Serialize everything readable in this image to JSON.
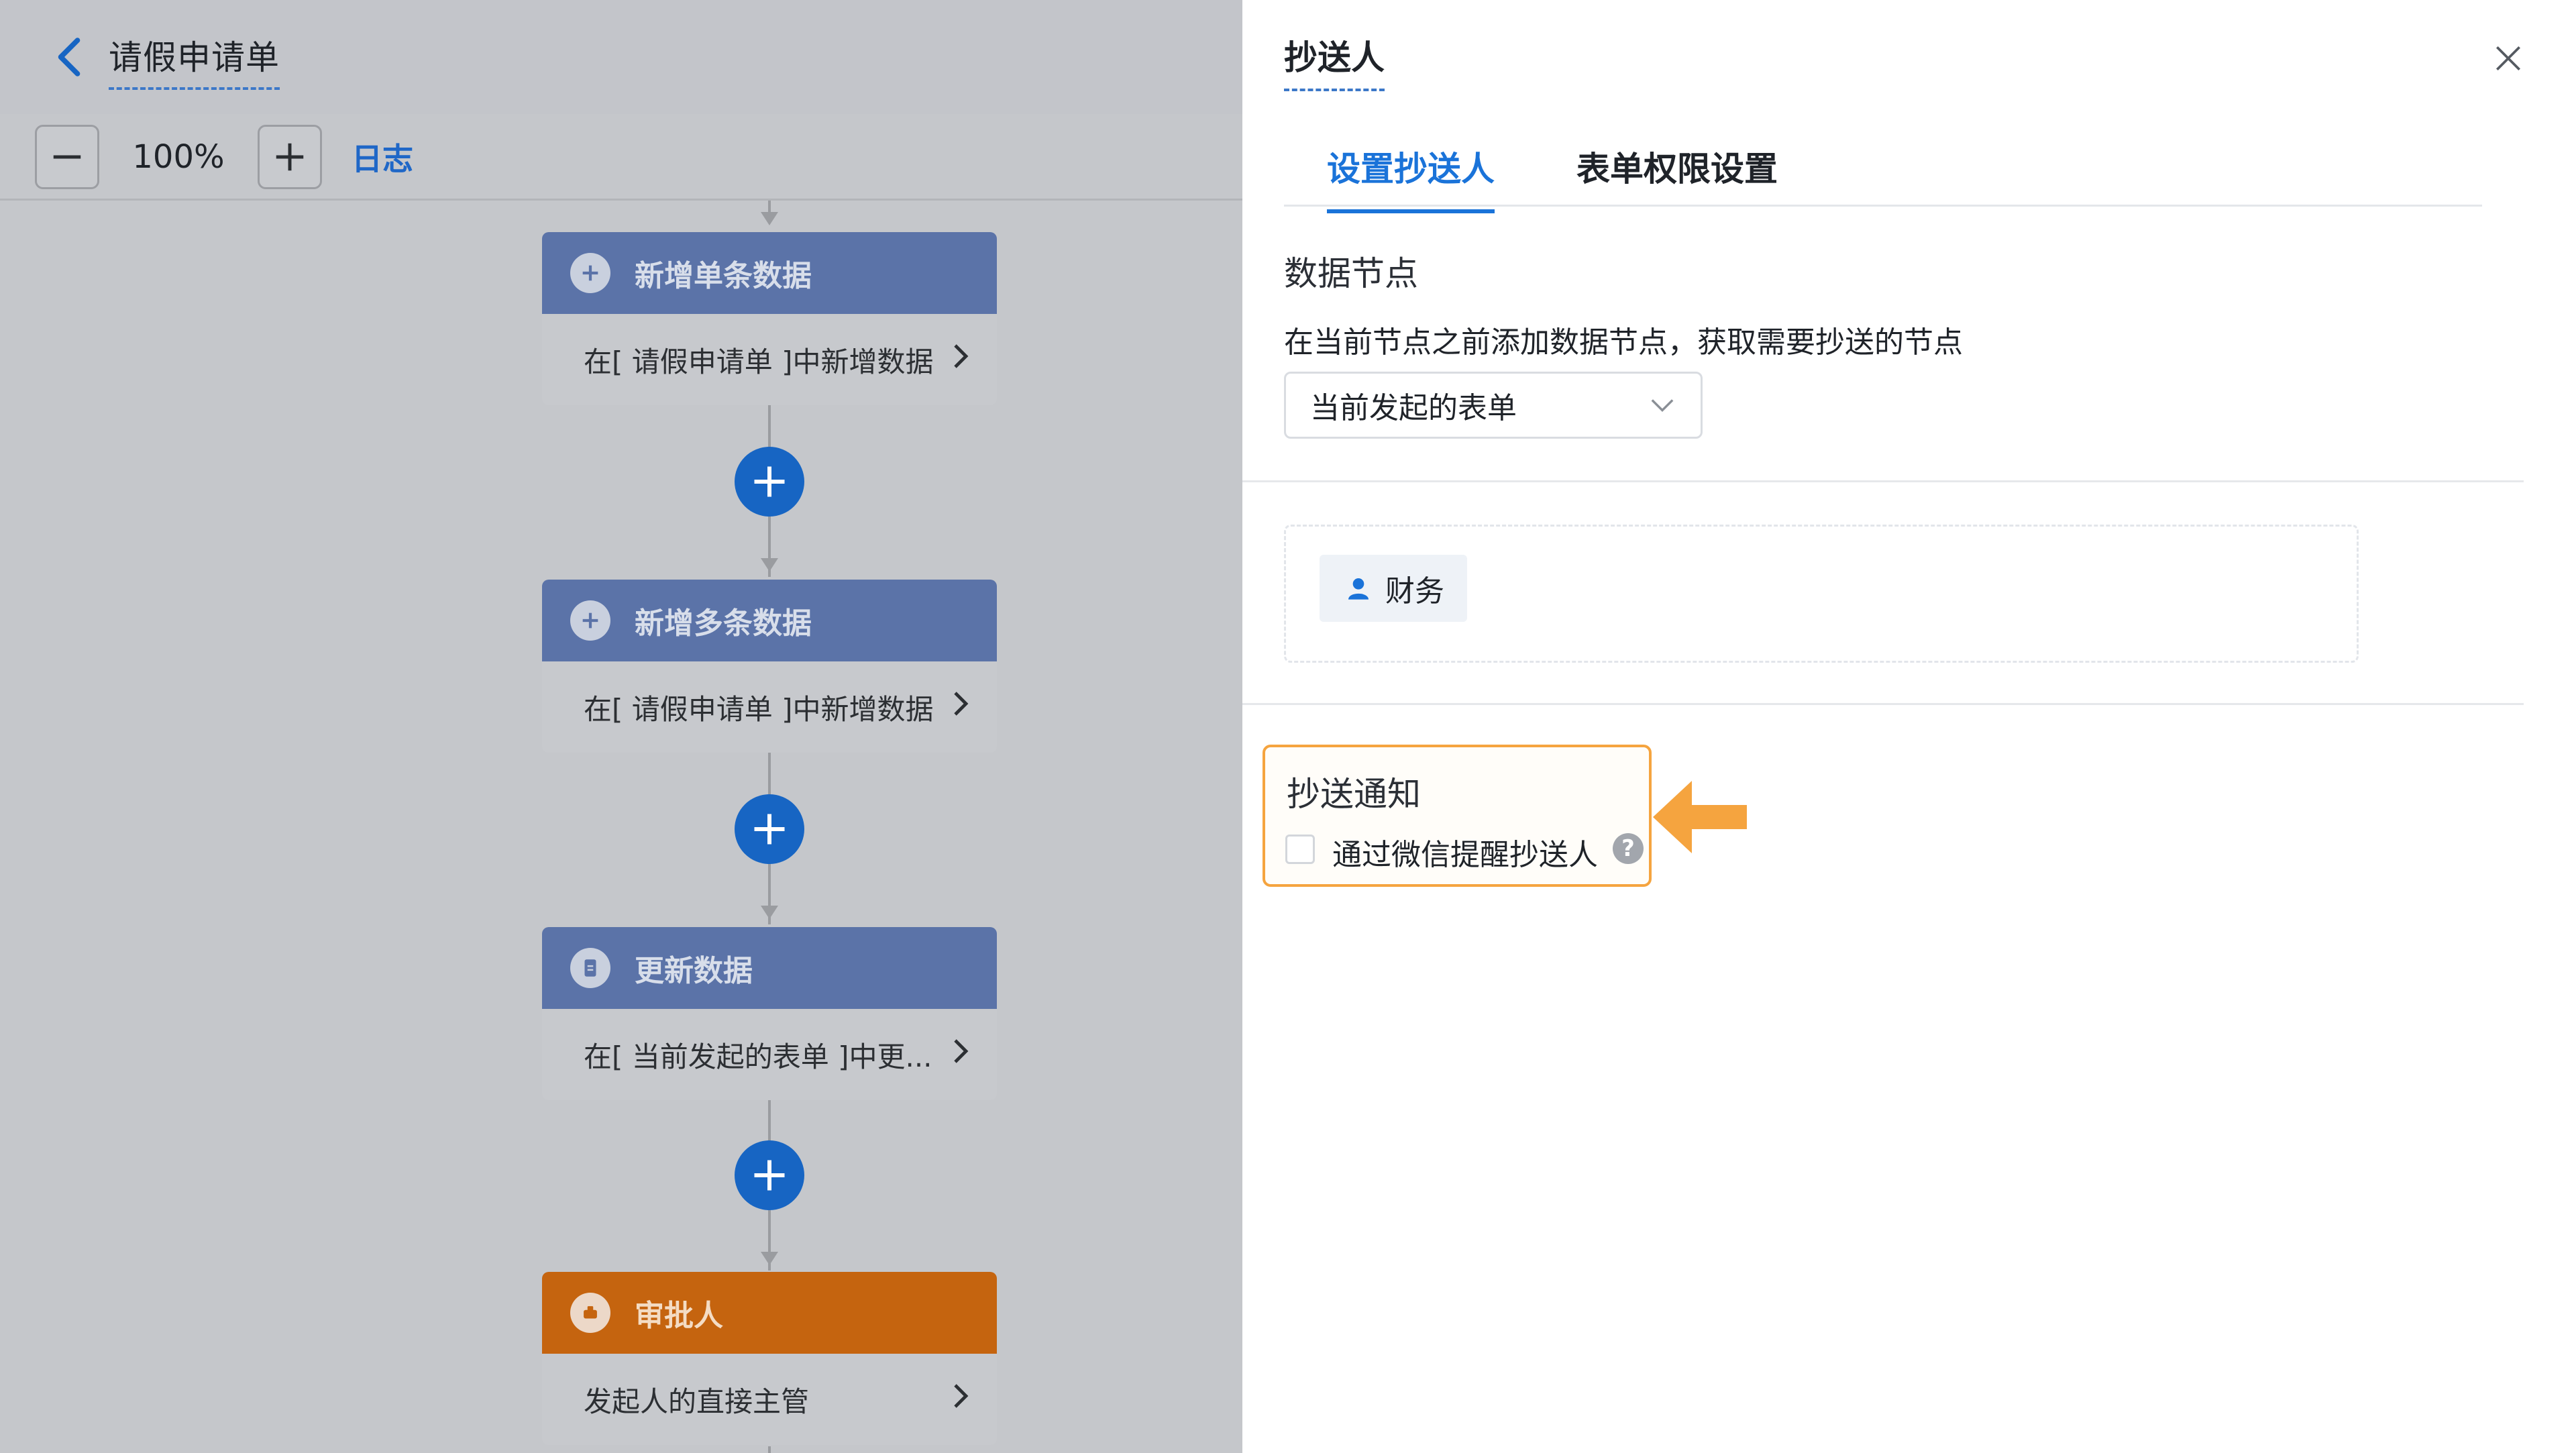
{
  "header": {
    "back_icon": "chevron-left-icon",
    "form_title": "请假申请单"
  },
  "toolbar": {
    "zoom_out_icon": "minus-icon",
    "zoom_level": "100%",
    "zoom_in_icon": "plus-icon",
    "log_label": "日志"
  },
  "flow": {
    "nodes": [
      {
        "icon": "plus-circle-icon",
        "title": "新增单条数据",
        "detail": "在[ 请假申请单 ]中新增数据"
      },
      {
        "icon": "plus-circle-icon",
        "title": "新增多条数据",
        "detail": "在[ 请假申请单 ]中新增数据"
      },
      {
        "icon": "document-icon",
        "title": "更新数据",
        "detail": "在[ 当前发起的表单 ]中更..."
      },
      {
        "icon": "approver-icon",
        "title": "审批人",
        "detail": "发起人的直接主管"
      }
    ],
    "add_icon": "plus-icon"
  },
  "panel": {
    "title": "抄送人",
    "close_icon": "close-icon",
    "tabs": [
      {
        "label": "设置抄送人",
        "active": true
      },
      {
        "label": "表单权限设置",
        "active": false
      }
    ],
    "data_node": {
      "label": "数据节点",
      "description": "在当前节点之前添加数据节点，获取需要抄送的节点",
      "selected": "当前发起的表单"
    },
    "recipients": [
      {
        "icon": "user-icon",
        "name": "财务"
      }
    ],
    "notify": {
      "title": "抄送通知",
      "checkbox_label": "通过微信提醒抄送人",
      "checked": false,
      "help_icon": "question-icon",
      "help_glyph": "?"
    }
  },
  "colors": {
    "accent": "#1a73d9",
    "node_header": "#5b73a8",
    "approver_header": "#c5640f",
    "highlight": "#f5a43f"
  }
}
